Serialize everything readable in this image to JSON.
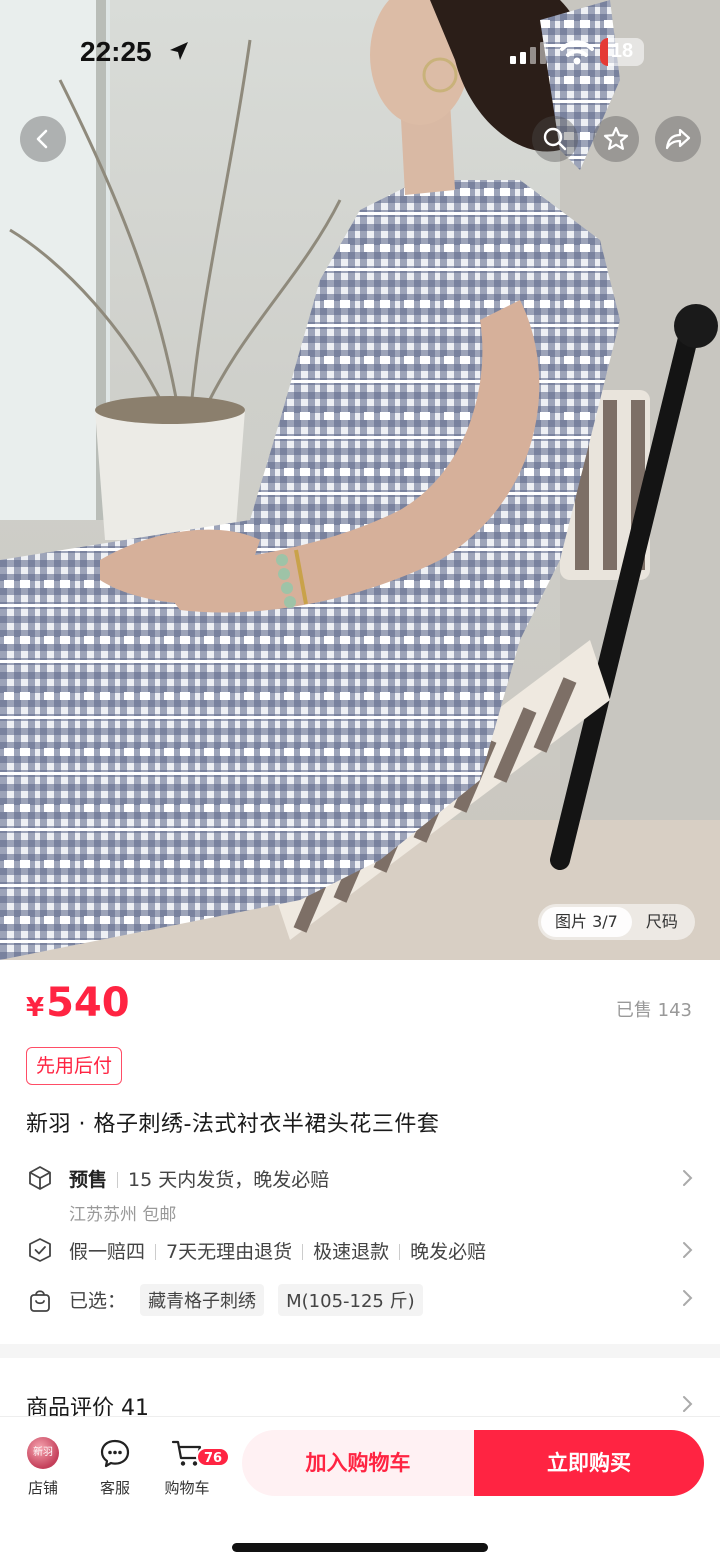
{
  "status_bar": {
    "time": "22:25",
    "battery": "18"
  },
  "gallery": {
    "counter": "图片 3/7",
    "size_label": "尺码"
  },
  "product": {
    "currency": "¥",
    "price": "540",
    "sold": "已售 143",
    "pay_tag": "先用后付",
    "title": "新羽 · 格子刺绣-法式衬衣半裙头花三件套"
  },
  "shipping": {
    "label": "预售",
    "detail": "15 天内发货，晚发必赔",
    "origin": "江苏苏州 包邮"
  },
  "guarantee": [
    "假一赔四",
    "7天无理由退货",
    "极速退款",
    "晚发必赔"
  ],
  "selection": {
    "label": "已选：",
    "color": "藏青格子刺绣",
    "size": "M(105-125 斤)"
  },
  "reviews": {
    "label": "商品评价 41"
  },
  "bottom_bar": {
    "store_label": "店铺",
    "store_logo": "新羽",
    "service_label": "客服",
    "cart_label": "购物车",
    "cart_count": "76",
    "add_to_cart": "加入购物车",
    "buy_now": "立即购买"
  },
  "colors": {
    "accent": "#ff2442",
    "accent_light": "#fff1f3"
  }
}
